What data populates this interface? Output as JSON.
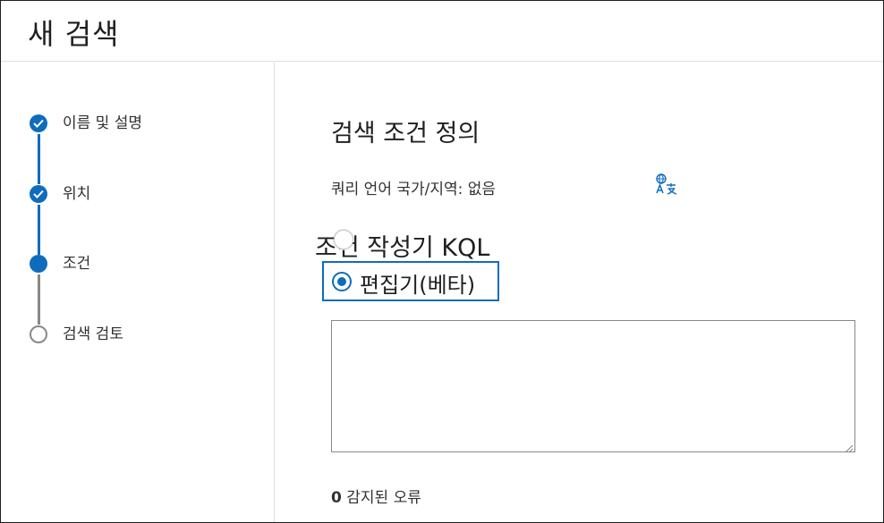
{
  "header": {
    "title": "새 검색"
  },
  "steps": [
    {
      "label": "이름 및 설명",
      "state": "done"
    },
    {
      "label": "위치",
      "state": "done"
    },
    {
      "label": "조건",
      "state": "current"
    },
    {
      "label": "검색 검토",
      "state": "todo"
    }
  ],
  "main": {
    "section_title": "검색 조건 정의",
    "query_language": "쿼리 언어 국가/지역: 없음",
    "translate_icon": "language-translate-icon",
    "builder_title": "조건 작성기 KQL",
    "editor_option_label": "편집기(베타)",
    "kql_value": "",
    "error_count": "0",
    "error_label": " 감지된 오류"
  },
  "colors": {
    "accent": "#0f6cbd",
    "inactive": "#8a8886",
    "divider": "#e1dfdd"
  }
}
